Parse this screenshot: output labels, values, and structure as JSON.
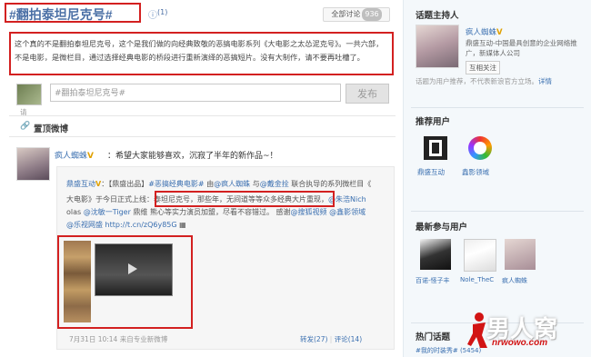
{
  "header": {
    "title": "#翻拍泰坦尼克号#",
    "count_icon": "info-circle-icon",
    "count": "(1)",
    "all_label": "全部讨论",
    "all_count": "936"
  },
  "description": "这个真的不是翻拍泰坦尼克号，这个是我们做的向经典致敬的恶搞电影系列《大电影之太怂泥克号》。一共六部，不是电影，是微栏目，通过选择经典电影的桥段进行重新演绎的恶搞短片。没有大制作，请不要再吐槽了。",
  "compose": {
    "placeholder": "#翻拍泰坦尼克号#",
    "send_label": "发布",
    "hint": "请"
  },
  "section": {
    "icon": "link-icon",
    "title": "置顶微博"
  },
  "post": {
    "author": "疯人蜘蛛",
    "verified": "V",
    "text": "：希望大家能够喜欢，沉寂了半年的新作品~！",
    "quote": {
      "author": "鼎盛互动",
      "verified": "V",
      "line1_a": "：【鼎盛出品】",
      "line1_link": "#恶搞经典电影#",
      "line1_b": " 由",
      "line1_at1": "@疯人蜘蛛",
      "line1_c": " 与",
      "line1_at2": "@戴金拴",
      "line1_d": " 联合执导的系列微栏目《",
      "line2_a": "大电影》于今日正式上线：",
      "line2_box": "泰坦尼克号，那些年，无间道等等众多经典大片重现",
      "line2_b": "，",
      "line2_at": "@朱浩Nich",
      "line3_a": "olas",
      "line3_at1": "@沈敏一Tiger",
      "line3_b": " 鼎维 熊心等实力演员加盟，尽看不容错过。 感谢",
      "line3_at2": "@搜狐视频",
      "line3_at3": "@鑫影领域",
      "line4_at": "@乐视网盛",
      "line4_url": "http://t.cn/zQ6y85G",
      "line4_icon": "video-icon",
      "time": "7月31日 10:14",
      "source": "来自专业新微博",
      "forward": "转发(27)",
      "comment": "评论(14)"
    }
  },
  "sidebar": {
    "host_title": "话题主持人",
    "host_name": "疯人蜘蛛",
    "host_verified": "V",
    "host_desc": "鼎盛互动-中国最具创意的企业网络推广，新媒体人公司",
    "follow_label": "互相关注",
    "apply_text": "话题为用户推荐，不代表新浪官方立场。",
    "apply_link": "详情",
    "rec_title": "推荐用户",
    "rec_users": [
      "鼎盛互动",
      "鑫影领域"
    ],
    "recent_title": "最新参与用户",
    "recent_users": [
      "百诺-怪子丰",
      "Nole_TheC",
      "疯人蜘蛛"
    ],
    "hot_title": "热门话题",
    "hot_item": "#我的时装秀# (5454)",
    "brand": "男人窝",
    "brand_url": "nrwowo.com"
  }
}
